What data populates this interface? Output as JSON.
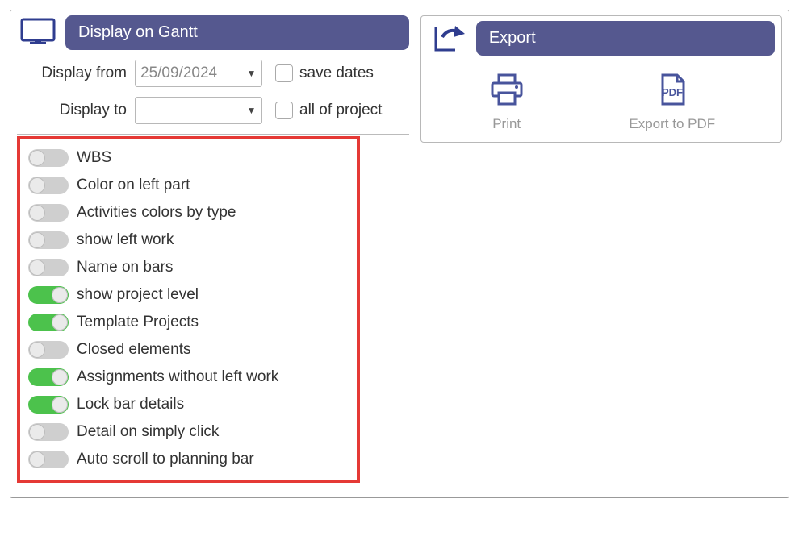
{
  "gantt": {
    "title": "Display on Gantt",
    "display_from_label": "Display from",
    "display_from_value": "25/09/2024",
    "display_to_label": "Display to",
    "display_to_value": "",
    "save_dates_label": "save dates",
    "all_of_project_label": "all of project",
    "toggles": [
      {
        "label": "WBS",
        "on": false
      },
      {
        "label": "Color on left part",
        "on": false
      },
      {
        "label": "Activities colors by type",
        "on": false
      },
      {
        "label": "show left work",
        "on": false
      },
      {
        "label": "Name on bars",
        "on": false
      },
      {
        "label": "show project level",
        "on": true
      },
      {
        "label": "Template Projects",
        "on": true
      },
      {
        "label": "Closed elements",
        "on": false
      },
      {
        "label": "Assignments without left work",
        "on": true
      },
      {
        "label": "Lock bar details",
        "on": true
      },
      {
        "label": "Detail on simply click",
        "on": false
      },
      {
        "label": "Auto scroll to planning bar",
        "on": false
      }
    ]
  },
  "export": {
    "title": "Export",
    "print_label": "Print",
    "pdf_label": "Export to PDF"
  }
}
